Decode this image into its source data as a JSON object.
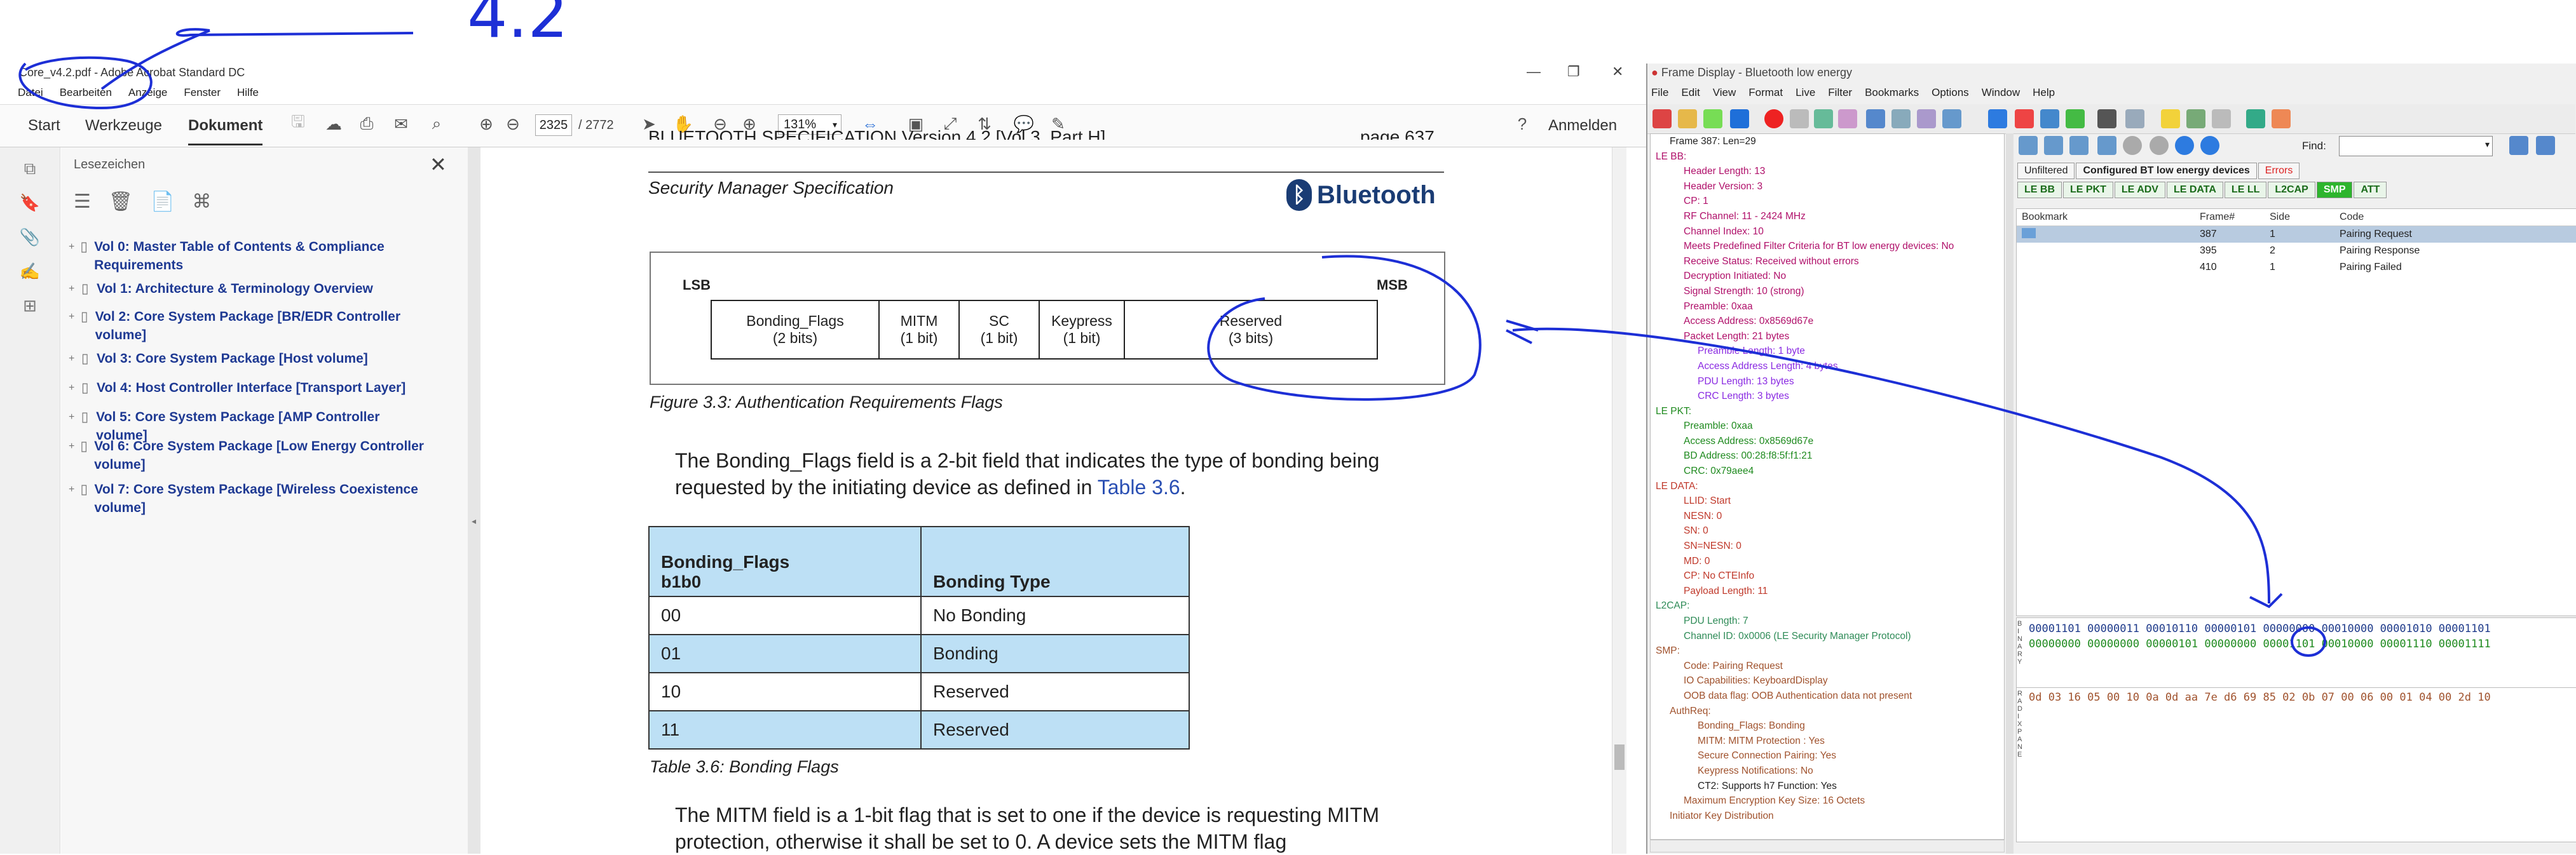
{
  "acrobat": {
    "title": "Core_v4.2.pdf - Adobe Acrobat Standard DC",
    "menu": [
      "Datei",
      "Bearbeiten",
      "Anzeige",
      "Fenster",
      "Hilfe"
    ],
    "tabs": {
      "start": "Start",
      "tools": "Werkzeuge",
      "document": "Dokument"
    },
    "page_current": "2325",
    "page_total": "/ 2772",
    "zoom": "131%",
    "signin": "Anmelden",
    "bookmarks_title": "Lesezeichen",
    "bookmarks": [
      "Vol 0: Master Table of Contents & Compliance Requirements",
      "Vol 1: Architecture & Terminology Overview",
      "Vol 2: Core System Package [BR/EDR Controller volume]",
      "Vol 3: Core System Package [Host volume]",
      "Vol 4: Host Controller Interface [Transport Layer]",
      "Vol 5: Core System Package [AMP Controller volume]",
      "Vol 6: Core System Package [Low Energy Controller volume]",
      "Vol 7: Core System Package [Wireless Coexistence volume]"
    ],
    "doc": {
      "header_left": "BLUETOOTH SPECIFICATION Version 4.2 [Vol 3, Part H]",
      "header_right": "page 637",
      "subheader": "Security Manager Specification",
      "logo": "Bluetooth",
      "lsb": "LSB",
      "msb": "MSB",
      "fields": [
        {
          "name": "Bonding_Flags",
          "size": "(2 bits)"
        },
        {
          "name": "MITM",
          "size": "(1 bit)"
        },
        {
          "name": "SC",
          "size": "(1 bit)"
        },
        {
          "name": "Keypress",
          "size": "(1 bit)"
        },
        {
          "name": "Reserved",
          "size": "(3 bits)"
        }
      ],
      "fig_caption": "Figure 3.3:  Authentication Requirements Flags",
      "para1_a": "The Bonding_Flags field is a 2-bit field that indicates the type of bonding being requested by the initiating device as defined in ",
      "para1_link": "Table 3.6",
      "para1_b": ".",
      "table_head": {
        "col1": "Bonding_Flags",
        "col1_sub": "b1b0",
        "col2": "Bonding Type"
      },
      "table_rows": [
        {
          "flags": "00",
          "type": "No Bonding"
        },
        {
          "flags": "01",
          "type": "Bonding"
        },
        {
          "flags": "10",
          "type": "Reserved"
        },
        {
          "flags": "11",
          "type": "Reserved"
        }
      ],
      "table_caption": "Table 3.6:  Bonding Flags",
      "para2": "The MITM field is a 1-bit flag that is set to one if the device is requesting MITM protection, otherwise it shall be set to 0. A device sets the MITM flag"
    },
    "annotation": "4.2"
  },
  "frame_display": {
    "title": "Frame Display - Bluetooth low energy",
    "menu": [
      "File",
      "Edit",
      "View",
      "Format",
      "Live",
      "Filter",
      "Bookmarks",
      "Options",
      "Window",
      "Help"
    ],
    "find_label": "Find:",
    "tree": [
      {
        "t": "Frame 387: Len=29",
        "c": "#222",
        "i": 1
      },
      {
        "t": "LE BB:",
        "c": "#b0106a",
        "i": 0
      },
      {
        "t": "Header Length: 13",
        "c": "#b0106a",
        "i": 2
      },
      {
        "t": "Header Version: 3",
        "c": "#b0106a",
        "i": 2
      },
      {
        "t": "CP: 1",
        "c": "#b0106a",
        "i": 2
      },
      {
        "t": "RF Channel: 11 - 2424 MHz",
        "c": "#b0106a",
        "i": 2
      },
      {
        "t": "Channel Index: 10",
        "c": "#b0106a",
        "i": 2
      },
      {
        "t": "Meets Predefined Filter Criteria for BT low energy devices: No",
        "c": "#b0106a",
        "i": 2
      },
      {
        "t": "Receive Status: Received without errors",
        "c": "#b0106a",
        "i": 2
      },
      {
        "t": "Decryption Initiated: No",
        "c": "#b0106a",
        "i": 2
      },
      {
        "t": "Signal Strength: 10 (strong)",
        "c": "#b0106a",
        "i": 2
      },
      {
        "t": "Preamble: 0xaa",
        "c": "#b0106a",
        "i": 2
      },
      {
        "t": "Access Address: 0x8569d67e",
        "c": "#b0106a",
        "i": 2
      },
      {
        "t": "Packet Length: 21  bytes",
        "c": "#b0106a",
        "i": 2
      },
      {
        "t": "Preamble Length: 1 byte",
        "c": "#8a2be2",
        "i": 3
      },
      {
        "t": "Access Address Length: 4 bytes",
        "c": "#8a2be2",
        "i": 3
      },
      {
        "t": "PDU Length: 13 bytes",
        "c": "#8a2be2",
        "i": 3
      },
      {
        "t": "CRC Length: 3 bytes",
        "c": "#8a2be2",
        "i": 3
      },
      {
        "t": "LE PKT:",
        "c": "#1e8a1e",
        "i": 0
      },
      {
        "t": "Preamble: 0xaa",
        "c": "#1e8a1e",
        "i": 2
      },
      {
        "t": "Access Address: 0x8569d67e",
        "c": "#1e8a1e",
        "i": 2
      },
      {
        "t": "BD Address: 00:28:f8:5f:f1:21",
        "c": "#1e8a1e",
        "i": 2
      },
      {
        "t": "CRC: 0x79aee4",
        "c": "#1e8a1e",
        "i": 2
      },
      {
        "t": "LE DATA:",
        "c": "#c0392b",
        "i": 0
      },
      {
        "t": "LLID: Start",
        "c": "#c0392b",
        "i": 2
      },
      {
        "t": "NESN: 0",
        "c": "#c0392b",
        "i": 2
      },
      {
        "t": "SN: 0",
        "c": "#c0392b",
        "i": 2
      },
      {
        "t": "SN=NESN: 0",
        "c": "#c0392b",
        "i": 2
      },
      {
        "t": "MD: 0",
        "c": "#c0392b",
        "i": 2
      },
      {
        "t": "CP: No CTEInfo",
        "c": "#c0392b",
        "i": 2
      },
      {
        "t": "Payload Length: 11",
        "c": "#c0392b",
        "i": 2
      },
      {
        "t": "L2CAP:",
        "c": "#2e8b57",
        "i": 0
      },
      {
        "t": "PDU Length: 7",
        "c": "#2e8b57",
        "i": 2
      },
      {
        "t": "Channel ID: 0x0006  (LE Security Manager Protocol)",
        "c": "#2e8b57",
        "i": 2
      },
      {
        "t": "SMP:",
        "c": "#a0522d",
        "i": 0
      },
      {
        "t": "Code: Pairing Request",
        "c": "#a0522d",
        "i": 2
      },
      {
        "t": "IO Capabilities: KeyboardDisplay",
        "c": "#a0522d",
        "i": 2
      },
      {
        "t": "OOB data flag: OOB Authentication data not present",
        "c": "#a0522d",
        "i": 2
      },
      {
        "t": "AuthReq:",
        "c": "#a0522d",
        "i": 1
      },
      {
        "t": "Bonding_Flags: Bonding",
        "c": "#a0522d",
        "i": 3
      },
      {
        "t": "MITM: MITM Protection : Yes",
        "c": "#a0522d",
        "i": 3
      },
      {
        "t": "Secure Connection Pairing: Yes",
        "c": "#a0522d",
        "i": 3
      },
      {
        "t": "Keypress Notifications: No",
        "c": "#a0522d",
        "i": 3
      },
      {
        "t": "CT2: Supports h7 Function: Yes",
        "c": "#222",
        "i": 3
      },
      {
        "t": "Maximum Encryption Key Size: 16 Octets",
        "c": "#a0522d",
        "i": 2
      },
      {
        "t": "Initiator Key Distribution",
        "c": "#a0522d",
        "i": 1
      }
    ],
    "tabs1": [
      "Unfiltered",
      "Configured BT low energy devices",
      "Errors"
    ],
    "tabs2": [
      "LE BB",
      "LE PKT",
      "LE ADV",
      "LE DATA",
      "LE LL",
      "L2CAP",
      "SMP",
      "ATT"
    ],
    "summary_head": {
      "bookmark": "Bookmark",
      "frame": "Frame#",
      "side": "Side",
      "code": "Code"
    },
    "summary_rows": [
      {
        "frame": "387",
        "side": "1",
        "code": "Pairing Request"
      },
      {
        "frame": "395",
        "side": "2",
        "code": "Pairing Response"
      },
      {
        "frame": "410",
        "side": "1",
        "code": "Pairing Failed"
      }
    ],
    "binary1": "00001101 00000011 00010110 00000101 00000000 00010000 00001010 00001101",
    "binary2": "00000000 00000000 00000101 00000000 00001101 00010000 00001110 00001111",
    "hex": "0d 03 16 05 00 10 0a 0d aa 7e d6 69 85 02 0b 07 00 06 00 01 04 00 2d 10"
  }
}
